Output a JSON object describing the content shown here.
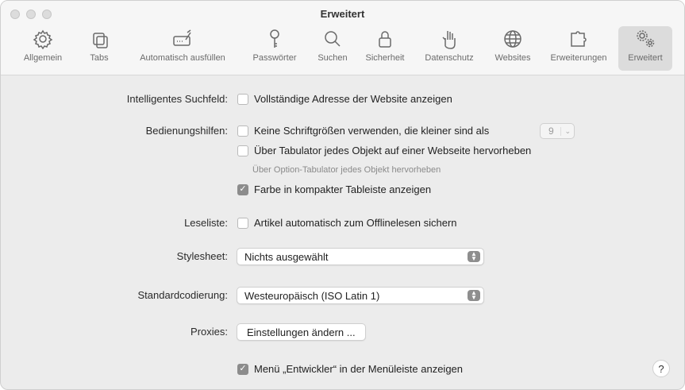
{
  "window": {
    "title": "Erweitert"
  },
  "toolbar": {
    "items": [
      {
        "label": "Allgemein",
        "icon": "gear-icon"
      },
      {
        "label": "Tabs",
        "icon": "tabs-icon"
      },
      {
        "label": "Automatisch ausfüllen",
        "icon": "autofill-icon"
      },
      {
        "label": "Passwörter",
        "icon": "key-icon"
      },
      {
        "label": "Suchen",
        "icon": "search-icon"
      },
      {
        "label": "Sicherheit",
        "icon": "lock-icon"
      },
      {
        "label": "Datenschutz",
        "icon": "hand-icon"
      },
      {
        "label": "Websites",
        "icon": "globe-icon"
      },
      {
        "label": "Erweiterungen",
        "icon": "puzzle-icon"
      },
      {
        "label": "Erweitert",
        "icon": "gears-icon",
        "active": true
      }
    ]
  },
  "settings": {
    "smart_search": {
      "label": "Intelligentes Suchfeld:",
      "option": "Vollständige Adresse der Website anzeigen",
      "checked": false
    },
    "accessibility": {
      "label": "Bedienungshilfen:",
      "min_font_option": "Keine Schriftgrößen verwenden, die kleiner sind als",
      "min_font_value": "9",
      "min_font_checked": false,
      "tab_option": "Über Tabulator jedes Objekt auf einer Webseite hervorheben",
      "tab_checked": false,
      "tab_hint": "Über Option-Tabulator jedes Objekt hervorheben",
      "compact_color_option": "Farbe in kompakter Tableiste anzeigen",
      "compact_color_checked": true
    },
    "reading_list": {
      "label": "Leseliste:",
      "option": "Artikel automatisch zum Offlinelesen sichern",
      "checked": false
    },
    "stylesheet": {
      "label": "Stylesheet:",
      "value": "Nichts ausgewählt"
    },
    "encoding": {
      "label": "Standardcodierung:",
      "value": "Westeuropäisch (ISO Latin 1)"
    },
    "proxies": {
      "label": "Proxies:",
      "button": "Einstellungen ändern ..."
    },
    "developer_menu": {
      "option": "Menü „Entwickler“ in der Menüleiste anzeigen",
      "checked": true
    },
    "help_label": "?"
  }
}
